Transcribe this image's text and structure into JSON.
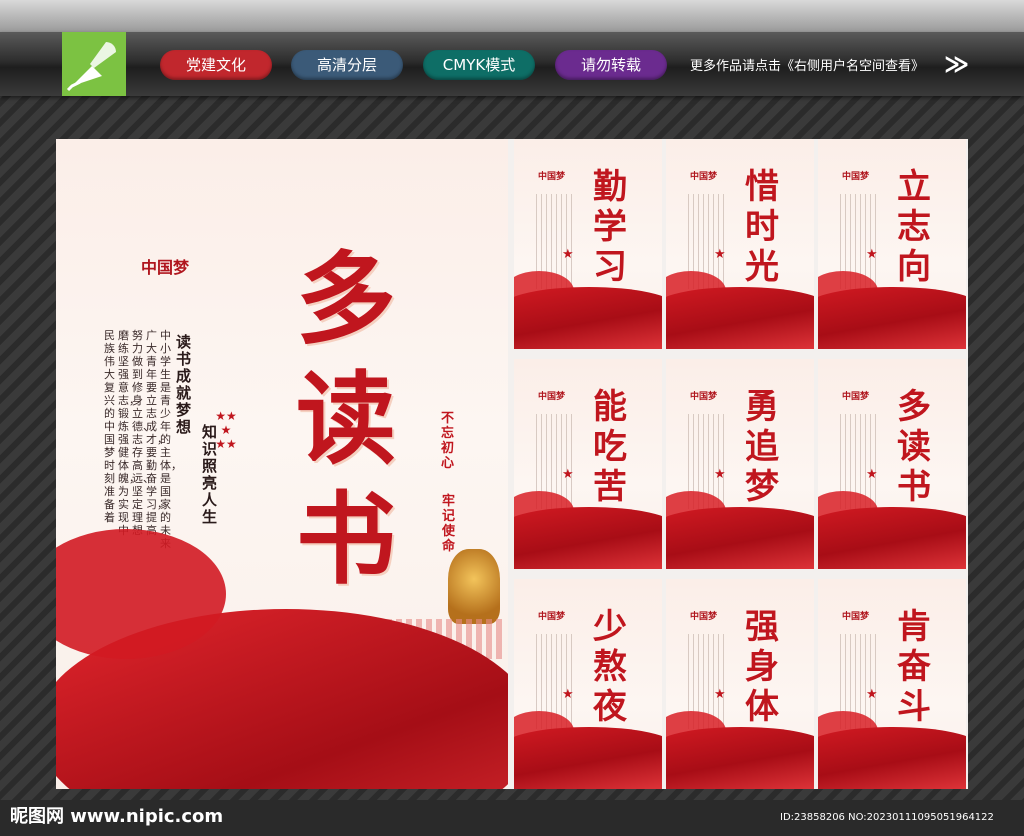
{
  "header": {
    "tags": [
      "党建文化",
      "高清分层",
      "CMYK模式",
      "请勿转载"
    ],
    "note": "更多作品请点击《右侧用户名空间查看》",
    "arrow": "≫"
  },
  "main_poster": {
    "title": [
      "多",
      "读",
      "书"
    ],
    "slogan_a": "读书成就梦想",
    "slogan_b": "知识照亮人生",
    "brand": "中国梦",
    "seal_a": "不忘初心",
    "seal_b": "牢记使命",
    "body_lines": [
      "中小学生是青少年的主体，是国家的未来",
      "广大青年要立志成才，要勤奋学习，提高",
      "努力做到修身立德、志存高远、坚定理想",
      "磨练坚强意志，锻炼强健体魄，为实现中",
      "民族伟大复兴的中国梦时刻准备着"
    ]
  },
  "small_posters": [
    {
      "title": [
        "勤",
        "学",
        "习"
      ]
    },
    {
      "title": [
        "惜",
        "时",
        "光"
      ]
    },
    {
      "title": [
        "立",
        "志",
        "向"
      ]
    },
    {
      "title": [
        "能",
        "吃",
        "苦"
      ]
    },
    {
      "title": [
        "勇",
        "追",
        "梦"
      ]
    },
    {
      "title": [
        "多",
        "读",
        "书"
      ]
    },
    {
      "title": [
        "少",
        "熬",
        "夜"
      ]
    },
    {
      "title": [
        "强",
        "身",
        "体"
      ]
    },
    {
      "title": [
        "肯",
        "奋",
        "斗"
      ]
    }
  ],
  "footer": {
    "site": "昵图网 www.nipic.com",
    "id": "ID:23858206 NO:20230111095051964122"
  },
  "colors": {
    "accent_red": "#c0161e",
    "logo_green": "#7cc242"
  }
}
